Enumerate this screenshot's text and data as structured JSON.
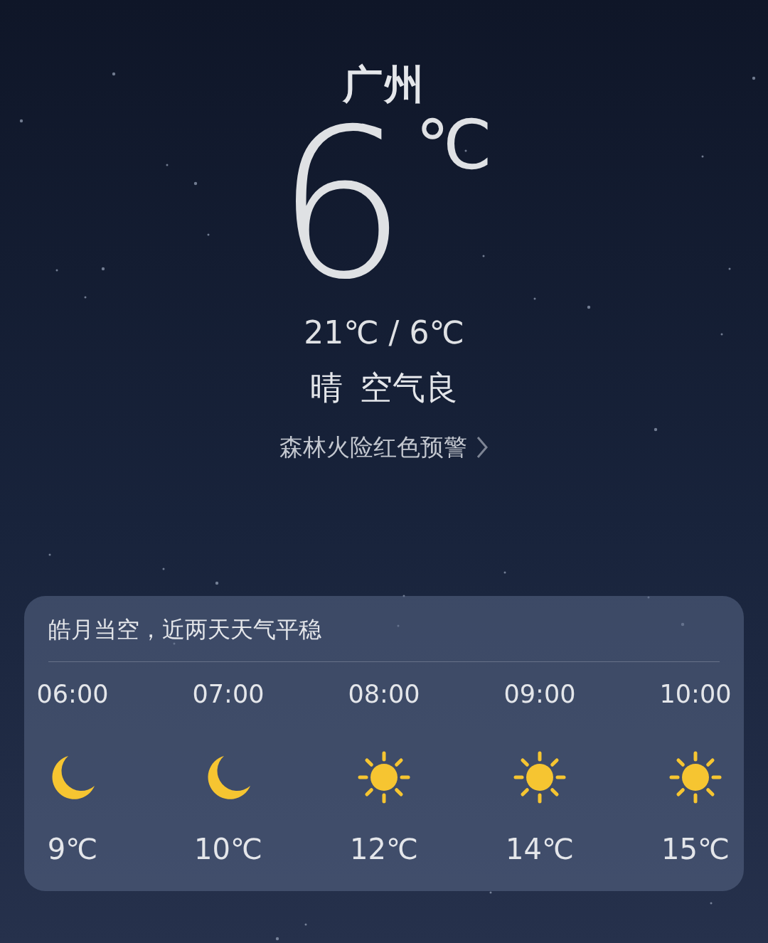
{
  "city": "广州",
  "current": {
    "temperature": "6",
    "unit": "℃",
    "range": "21℃ / 6℃",
    "condition": "晴",
    "air_quality": "空气良"
  },
  "alert": {
    "text": "森林火险红色预警"
  },
  "forecast": {
    "summary": "皓月当空，近两天天气平稳",
    "hours": [
      {
        "time": "06:00",
        "kind": "moon",
        "temp": "9℃"
      },
      {
        "time": "07:00",
        "kind": "moon",
        "temp": "10℃"
      },
      {
        "time": "08:00",
        "kind": "sun",
        "temp": "12℃"
      },
      {
        "time": "09:00",
        "kind": "sun",
        "temp": "14℃"
      },
      {
        "time": "10:00",
        "kind": "sun",
        "temp": "15℃"
      }
    ]
  }
}
